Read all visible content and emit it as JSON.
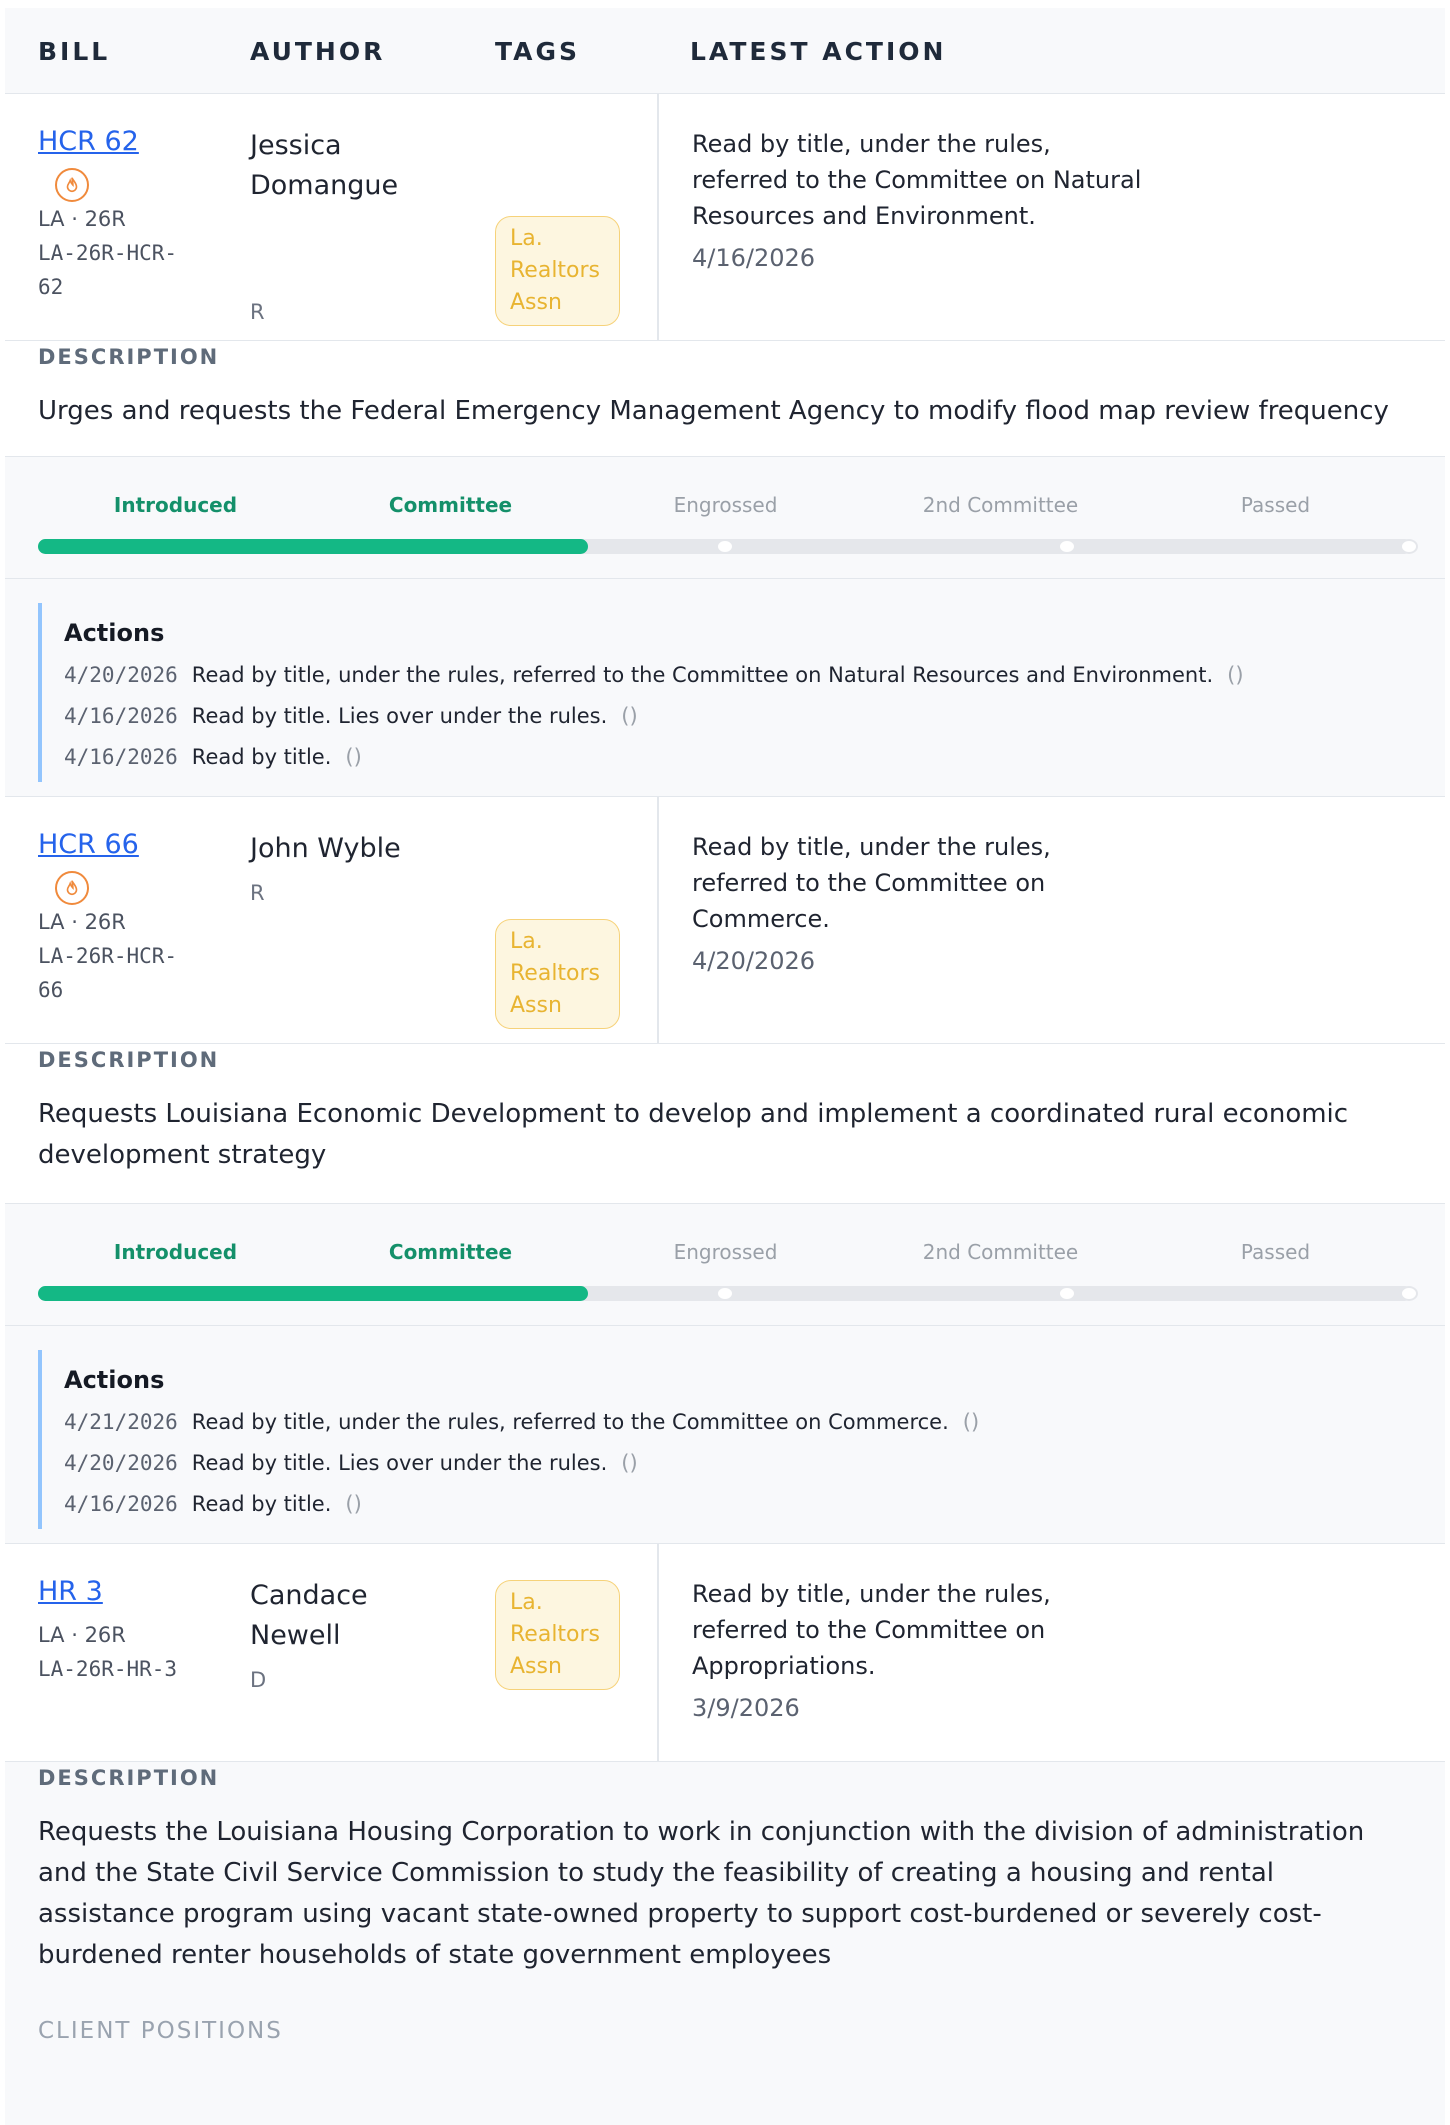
{
  "header": {
    "bill": "BILL",
    "author": "AUTHOR",
    "tags": "TAGS",
    "latest_action": "LATEST ACTION"
  },
  "labels": {
    "description": "DESCRIPTION",
    "actions": "Actions",
    "client_positions": "CLIENT POSITIONS"
  },
  "stages": [
    "Introduced",
    "Committee",
    "Engrossed",
    "2nd Committee",
    "Passed"
  ],
  "bills": [
    {
      "id": "HCR 62",
      "state_session": "LA · 26R",
      "code": "LA-26R-HCR-62",
      "author": "Jessica Domangue",
      "party": "R",
      "tag": "La. Realtors Assn",
      "latest_action": "Read by title, under the rules, referred to the Committee on Natural Resources and Environment.",
      "latest_date": "4/16/2026",
      "description": "Urges and requests the Federal Emergency Management Agency to modify flood map review frequency",
      "progress_stage": 2,
      "actions": [
        {
          "date": "4/20/2026",
          "text": "Read by title, under the rules, referred to the Committee on Natural Resources and Environment.",
          "paren": "()"
        },
        {
          "date": "4/16/2026",
          "text": "Read by title. Lies over under the rules.",
          "paren": "()"
        },
        {
          "date": "4/16/2026",
          "text": "Read by title.",
          "paren": "()"
        }
      ]
    },
    {
      "id": "HCR 66",
      "state_session": "LA · 26R",
      "code": "LA-26R-HCR-66",
      "author": "John Wyble",
      "party": "R",
      "tag": "La. Realtors Assn",
      "latest_action": "Read by title, under the rules, referred to the Committee on Commerce.",
      "latest_date": "4/20/2026",
      "description": "Requests Louisiana Economic Development to develop and implement a coordinated rural economic development strategy",
      "progress_stage": 2,
      "actions": [
        {
          "date": "4/21/2026",
          "text": "Read by title, under the rules, referred to the Committee on Commerce.",
          "paren": "()"
        },
        {
          "date": "4/20/2026",
          "text": "Read by title. Lies over under the rules.",
          "paren": "()"
        },
        {
          "date": "4/16/2026",
          "text": "Read by title.",
          "paren": "()"
        }
      ]
    },
    {
      "id": "HR 3",
      "state_session": "LA · 26R",
      "code": "LA-26R-HR-3",
      "author": "Candace Newell",
      "party": "D",
      "tag": "La. Realtors Assn",
      "latest_action": "Read by title, under the rules, referred to the Committee on Appropriations.",
      "latest_date": "3/9/2026",
      "description": "Requests the Louisiana Housing Corporation to work in conjunction with the division of administration and the State Civil Service Commission to study the feasibility of creating a housing and rental assistance program using vacant state-owned property to support cost-burdened or severely cost-burdened renter households of state government employees"
    }
  ],
  "colors": {
    "link": "#2563eb",
    "progress_fill": "#14b885",
    "tag_text": "#e8b431",
    "fire": "#f08a3c"
  }
}
